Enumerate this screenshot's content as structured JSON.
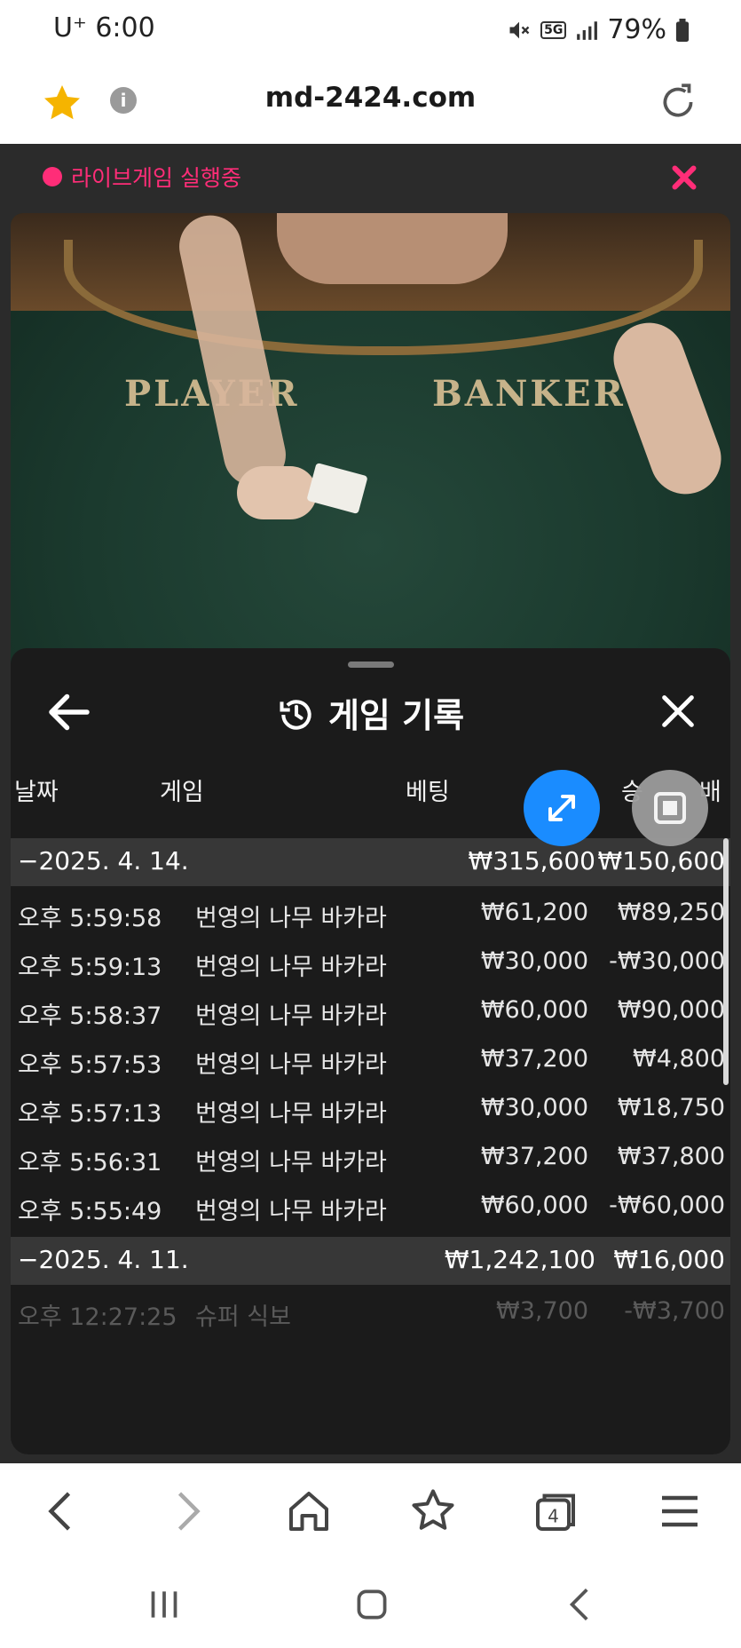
{
  "status_bar": {
    "carrier": "U⁺ 6:00",
    "network": "5G",
    "battery": "79%"
  },
  "address_bar": {
    "url": "md-2424.com"
  },
  "live_banner": {
    "text": "라이브게임 실행중"
  },
  "video": {
    "player_label": "PLAYER",
    "banker_label": "BANKER"
  },
  "history": {
    "title": "게임 기록",
    "columns": {
      "date": "날짜",
      "game": "게임",
      "bet": "베팅",
      "win": "승",
      "win_suffix": "배"
    },
    "groups": [
      {
        "date": "−2025. 4. 14.",
        "bet": "₩315,600",
        "win": "₩150,600",
        "rows": [
          {
            "time": "오후 5:59:58",
            "game": "번영의 나무 바카라",
            "bet": "₩61,200",
            "win": "₩89,250"
          },
          {
            "time": "오후 5:59:13",
            "game": "번영의 나무 바카라",
            "bet": "₩30,000",
            "win": "-₩30,000"
          },
          {
            "time": "오후 5:58:37",
            "game": "번영의 나무 바카라",
            "bet": "₩60,000",
            "win": "₩90,000"
          },
          {
            "time": "오후 5:57:53",
            "game": "번영의 나무 바카라",
            "bet": "₩37,200",
            "win": "₩4,800"
          },
          {
            "time": "오후 5:57:13",
            "game": "번영의 나무 바카라",
            "bet": "₩30,000",
            "win": "₩18,750"
          },
          {
            "time": "오후 5:56:31",
            "game": "번영의 나무 바카라",
            "bet": "₩37,200",
            "win": "₩37,800"
          },
          {
            "time": "오후 5:55:49",
            "game": "번영의 나무 바카라",
            "bet": "₩60,000",
            "win": "-₩60,000"
          }
        ]
      },
      {
        "date": "−2025. 4. 11.",
        "bet": "₩1,242,100",
        "win": "₩16,000",
        "rows": [
          {
            "time": "오후 12:27:25",
            "game": "슈퍼 식보",
            "bet": "₩3,700",
            "win": "-₩3,700"
          }
        ]
      }
    ]
  },
  "colors": {
    "live_accent": "#ff2d78",
    "fab_blue": "#1a8cff",
    "star": "#f5b400"
  }
}
